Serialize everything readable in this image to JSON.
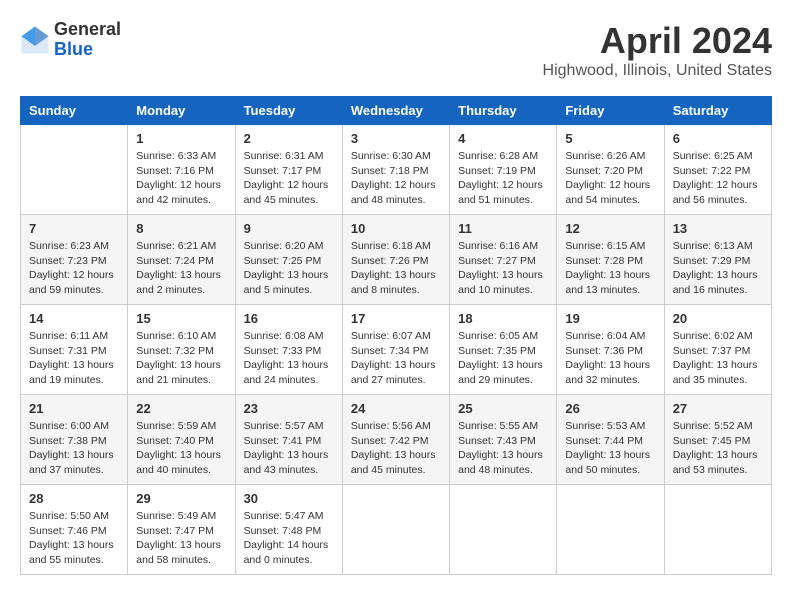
{
  "header": {
    "logo_general": "General",
    "logo_blue": "Blue",
    "month_title": "April 2024",
    "location": "Highwood, Illinois, United States"
  },
  "columns": [
    "Sunday",
    "Monday",
    "Tuesday",
    "Wednesday",
    "Thursday",
    "Friday",
    "Saturday"
  ],
  "weeks": [
    [
      {
        "day": "",
        "info": ""
      },
      {
        "day": "1",
        "info": "Sunrise: 6:33 AM\nSunset: 7:16 PM\nDaylight: 12 hours\nand 42 minutes."
      },
      {
        "day": "2",
        "info": "Sunrise: 6:31 AM\nSunset: 7:17 PM\nDaylight: 12 hours\nand 45 minutes."
      },
      {
        "day": "3",
        "info": "Sunrise: 6:30 AM\nSunset: 7:18 PM\nDaylight: 12 hours\nand 48 minutes."
      },
      {
        "day": "4",
        "info": "Sunrise: 6:28 AM\nSunset: 7:19 PM\nDaylight: 12 hours\nand 51 minutes."
      },
      {
        "day": "5",
        "info": "Sunrise: 6:26 AM\nSunset: 7:20 PM\nDaylight: 12 hours\nand 54 minutes."
      },
      {
        "day": "6",
        "info": "Sunrise: 6:25 AM\nSunset: 7:22 PM\nDaylight: 12 hours\nand 56 minutes."
      }
    ],
    [
      {
        "day": "7",
        "info": "Sunrise: 6:23 AM\nSunset: 7:23 PM\nDaylight: 12 hours\nand 59 minutes."
      },
      {
        "day": "8",
        "info": "Sunrise: 6:21 AM\nSunset: 7:24 PM\nDaylight: 13 hours\nand 2 minutes."
      },
      {
        "day": "9",
        "info": "Sunrise: 6:20 AM\nSunset: 7:25 PM\nDaylight: 13 hours\nand 5 minutes."
      },
      {
        "day": "10",
        "info": "Sunrise: 6:18 AM\nSunset: 7:26 PM\nDaylight: 13 hours\nand 8 minutes."
      },
      {
        "day": "11",
        "info": "Sunrise: 6:16 AM\nSunset: 7:27 PM\nDaylight: 13 hours\nand 10 minutes."
      },
      {
        "day": "12",
        "info": "Sunrise: 6:15 AM\nSunset: 7:28 PM\nDaylight: 13 hours\nand 13 minutes."
      },
      {
        "day": "13",
        "info": "Sunrise: 6:13 AM\nSunset: 7:29 PM\nDaylight: 13 hours\nand 16 minutes."
      }
    ],
    [
      {
        "day": "14",
        "info": "Sunrise: 6:11 AM\nSunset: 7:31 PM\nDaylight: 13 hours\nand 19 minutes."
      },
      {
        "day": "15",
        "info": "Sunrise: 6:10 AM\nSunset: 7:32 PM\nDaylight: 13 hours\nand 21 minutes."
      },
      {
        "day": "16",
        "info": "Sunrise: 6:08 AM\nSunset: 7:33 PM\nDaylight: 13 hours\nand 24 minutes."
      },
      {
        "day": "17",
        "info": "Sunrise: 6:07 AM\nSunset: 7:34 PM\nDaylight: 13 hours\nand 27 minutes."
      },
      {
        "day": "18",
        "info": "Sunrise: 6:05 AM\nSunset: 7:35 PM\nDaylight: 13 hours\nand 29 minutes."
      },
      {
        "day": "19",
        "info": "Sunrise: 6:04 AM\nSunset: 7:36 PM\nDaylight: 13 hours\nand 32 minutes."
      },
      {
        "day": "20",
        "info": "Sunrise: 6:02 AM\nSunset: 7:37 PM\nDaylight: 13 hours\nand 35 minutes."
      }
    ],
    [
      {
        "day": "21",
        "info": "Sunrise: 6:00 AM\nSunset: 7:38 PM\nDaylight: 13 hours\nand 37 minutes."
      },
      {
        "day": "22",
        "info": "Sunrise: 5:59 AM\nSunset: 7:40 PM\nDaylight: 13 hours\nand 40 minutes."
      },
      {
        "day": "23",
        "info": "Sunrise: 5:57 AM\nSunset: 7:41 PM\nDaylight: 13 hours\nand 43 minutes."
      },
      {
        "day": "24",
        "info": "Sunrise: 5:56 AM\nSunset: 7:42 PM\nDaylight: 13 hours\nand 45 minutes."
      },
      {
        "day": "25",
        "info": "Sunrise: 5:55 AM\nSunset: 7:43 PM\nDaylight: 13 hours\nand 48 minutes."
      },
      {
        "day": "26",
        "info": "Sunrise: 5:53 AM\nSunset: 7:44 PM\nDaylight: 13 hours\nand 50 minutes."
      },
      {
        "day": "27",
        "info": "Sunrise: 5:52 AM\nSunset: 7:45 PM\nDaylight: 13 hours\nand 53 minutes."
      }
    ],
    [
      {
        "day": "28",
        "info": "Sunrise: 5:50 AM\nSunset: 7:46 PM\nDaylight: 13 hours\nand 55 minutes."
      },
      {
        "day": "29",
        "info": "Sunrise: 5:49 AM\nSunset: 7:47 PM\nDaylight: 13 hours\nand 58 minutes."
      },
      {
        "day": "30",
        "info": "Sunrise: 5:47 AM\nSunset: 7:48 PM\nDaylight: 14 hours\nand 0 minutes."
      },
      {
        "day": "",
        "info": ""
      },
      {
        "day": "",
        "info": ""
      },
      {
        "day": "",
        "info": ""
      },
      {
        "day": "",
        "info": ""
      }
    ]
  ]
}
